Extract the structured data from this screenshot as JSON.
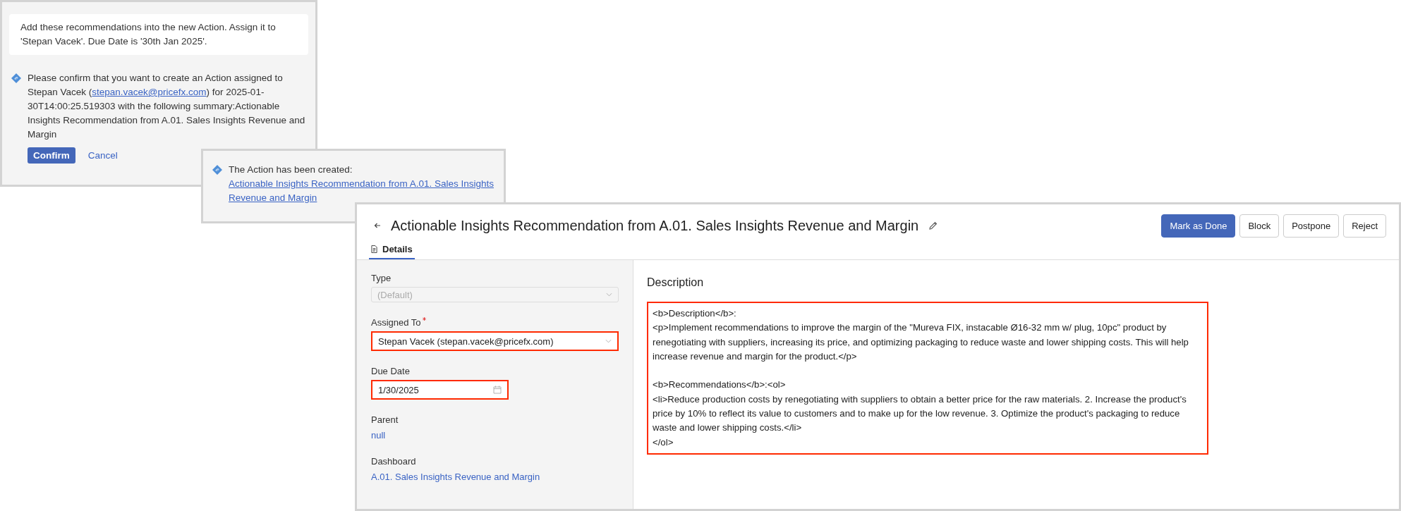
{
  "chat": {
    "user_message": "Add these recommendations into the new Action. Assign it to 'Stepan Vacek'. Due Date is '30th Jan 2025'.",
    "bot_message": {
      "text_before": "Please confirm that you want to create an Action assigned to Stepan Vacek (",
      "link": "stepan.vacek@pricefx.com",
      "text_after": ") for 2025-01-30T14:00:25.519303 with the following summary:Actionable Insights Recommendation from A.01. Sales Insights Revenue and Margin"
    },
    "buttons": [
      {
        "label": "Confirm",
        "kind": "primary"
      },
      {
        "label": "Cancel",
        "kind": "link"
      }
    ]
  },
  "notification": {
    "text": "The Action has been created:",
    "link": "Actionable Insights Recommendation from A.01. Sales Insights Revenue and Margin"
  },
  "action": {
    "title": "Actionable Insights Recommendation from A.01. Sales Insights Revenue and Margin",
    "buttons": [
      {
        "label": "Mark as Done",
        "primary": true
      },
      {
        "label": "Block",
        "primary": false
      },
      {
        "label": "Postpone",
        "primary": false
      },
      {
        "label": "Reject",
        "primary": false
      }
    ],
    "tabs": [
      {
        "label": "Details",
        "selected": true
      }
    ],
    "fields": [
      {
        "kind": "select",
        "label": "Type",
        "value": "(Default)",
        "disabled": true,
        "required": false,
        "highlighted": false
      },
      {
        "kind": "select",
        "label": "Assigned To",
        "value": "Stepan Vacek (stepan.vacek@pricefx.com)",
        "disabled": false,
        "required": true,
        "highlighted": true
      },
      {
        "kind": "date",
        "label": "Due Date",
        "value": "1/30/2025",
        "disabled": false,
        "required": false,
        "highlighted": true
      },
      {
        "kind": "link",
        "label": "Parent",
        "value": "null"
      },
      {
        "kind": "link",
        "label": "Dashboard",
        "value": "A.01. Sales Insights Revenue and Margin"
      }
    ],
    "description": {
      "heading": "Description",
      "highlighted": true,
      "text": "<b>Description</b>:\n<p>Implement recommendations to improve the margin of the \"Mureva FIX, instacable Ø16-32 mm w/ plug, 10pc\" product by renegotiating with suppliers, increasing its price, and optimizing packaging to reduce waste and lower shipping costs. This will help increase revenue and margin for the product.</p>\n\n<b>Recommendations</b>:<ol>\n<li>Reduce production costs by renegotiating with suppliers to obtain a better price for the raw materials. 2. Increase the product's price by 10% to reflect its value to customers and to make up for the low revenue. 3. Optimize the product's packaging to reduce waste and lower shipping costs.</li>\n</ol>"
    }
  }
}
